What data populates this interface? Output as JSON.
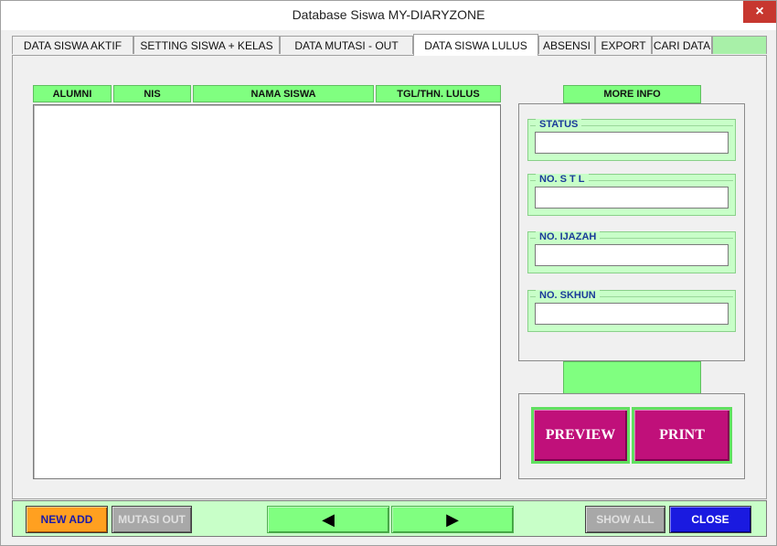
{
  "window": {
    "title": "Database Siswa MY-DIARYZONE",
    "close_glyph": "×"
  },
  "tabs": [
    {
      "label": "DATA SISWA AKTIF"
    },
    {
      "label": "SETTING SISWA + KELAS"
    },
    {
      "label": "DATA MUTASI - OUT"
    },
    {
      "label": "DATA SISWA LULUS"
    },
    {
      "label": "ABSENSI"
    },
    {
      "label": "EXPORT"
    },
    {
      "label": "CARI DATA"
    }
  ],
  "active_tab": "DATA SISWA LULUS",
  "table": {
    "columns": [
      "ALUMNI",
      "NIS",
      "NAMA SISWA",
      "TGL/THN. LULUS"
    ],
    "rows": []
  },
  "more_info": {
    "heading": "MORE INFO",
    "fields": [
      {
        "label": "STATUS",
        "value": ""
      },
      {
        "label": "NO. S T L",
        "value": ""
      },
      {
        "label": "NO. IJAZAH",
        "value": ""
      },
      {
        "label": "NO. SKHUN",
        "value": ""
      }
    ]
  },
  "actions": {
    "preview": "PREVIEW",
    "print": "PRINT"
  },
  "bottom": {
    "new_add": "NEW ADD",
    "mutasi_out": "MUTASI OUT",
    "prev_glyph": "◀",
    "next_glyph": "▶",
    "show_all": "SHOW ALL",
    "close": "CLOSE"
  },
  "colors": {
    "accent_green": "#80ff80",
    "panel_green": "#c8ffc8",
    "magenta": "#c0107a",
    "orange": "#ffa020",
    "blue": "#1a1ae0"
  }
}
